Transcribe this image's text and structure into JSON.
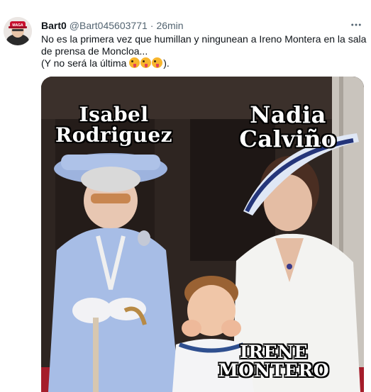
{
  "tweet": {
    "display_name": "Bart0",
    "handle": "@Bart045603771",
    "separator": "·",
    "time": "26min",
    "more_icon": "more-horizontal-icon",
    "text_line1": "No es la primera vez que humillan y ningunean a Ireno Montera en la sala de prensa de Moncloa...",
    "text_line2_prefix": "(Y no será la última ",
    "text_line2_suffix": ").",
    "emoji_icon": "zany-face-emoji",
    "emoji_count": 3
  },
  "media": {
    "labels": {
      "left_line1": "Isabel",
      "left_line2": "Rodriguez",
      "right_line1": "Nadia",
      "right_line2": "Calviño",
      "bottom_line1": "IRENE",
      "bottom_line2": "MONTERO"
    }
  },
  "colors": {
    "secondary_text": "#536471",
    "primary_text": "#0f1419",
    "background": "#ffffff"
  }
}
